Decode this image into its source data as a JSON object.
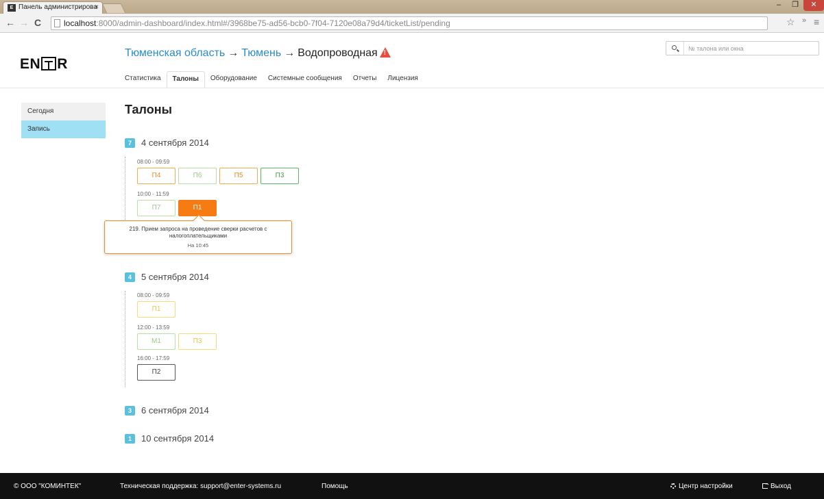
{
  "browser": {
    "tab_title": "Панель администрирова",
    "tab_favicon": "ENTER-logo-icon",
    "url_host": "localhost",
    "url_rest": ":8000/admin-dashboard/index.html#/3968be75-ad56-bcb0-7f04-7120e08a79d4/ticketList/pending"
  },
  "header": {
    "logo_text_left": "EN",
    "logo_text_right": "R",
    "breadcrumb": [
      "Тюменская область",
      "Тюмень",
      "Водопроводная"
    ],
    "arrow": "→",
    "search_placeholder": "№ талона или окна",
    "tabs": [
      "Статистика",
      "Талоны",
      "Оборудование",
      "Системные сообщения",
      "Отчеты",
      "Лицензия"
    ],
    "active_tab": "Талоны"
  },
  "sidebar": {
    "items": [
      "Сегодня",
      "Запись"
    ],
    "active": "Запись"
  },
  "main": {
    "title": "Талоны",
    "days": [
      {
        "badge": "7",
        "date": "4 сентября 2014",
        "slots": [
          {
            "time": "08:00 - 09:59",
            "tickets": [
              "П4",
              "П6",
              "П5",
              "П3"
            ]
          },
          {
            "time": "10:00 - 11:59",
            "tickets": [
              "П7",
              "П1"
            ]
          }
        ]
      },
      {
        "badge": "4",
        "date": "5 сентября 2014",
        "slots": [
          {
            "time": "08:00 - 09:59",
            "tickets": [
              "П1"
            ]
          },
          {
            "time": "12:00 - 13:59",
            "tickets": [
              "М1",
              "П3"
            ]
          },
          {
            "time": "16:00 - 17:59",
            "tickets": [
              "П2"
            ]
          }
        ]
      },
      {
        "badge": "3",
        "date": "6 сентября 2014"
      },
      {
        "badge": "1",
        "date": "10 сентября 2014"
      }
    ],
    "popover": {
      "text": "219. Прием запроса на проведение сверки расчетов с налогоплательщиками",
      "time": "На 10:45"
    }
  },
  "footer": {
    "company": "© ООО \"КОМИНТЕК\"",
    "support": "Техническая поддержка: support@enter-systems.ru",
    "help": "Помощь",
    "settings": "Центр настройки",
    "logout": "Выход"
  },
  "colors": {
    "accent_blue": "#2a8ccf",
    "sidebar_active": "#9fe0f4",
    "badge": "#5bc0de",
    "selected_ticket": "#f57b12",
    "warning": "#e84c3d"
  }
}
